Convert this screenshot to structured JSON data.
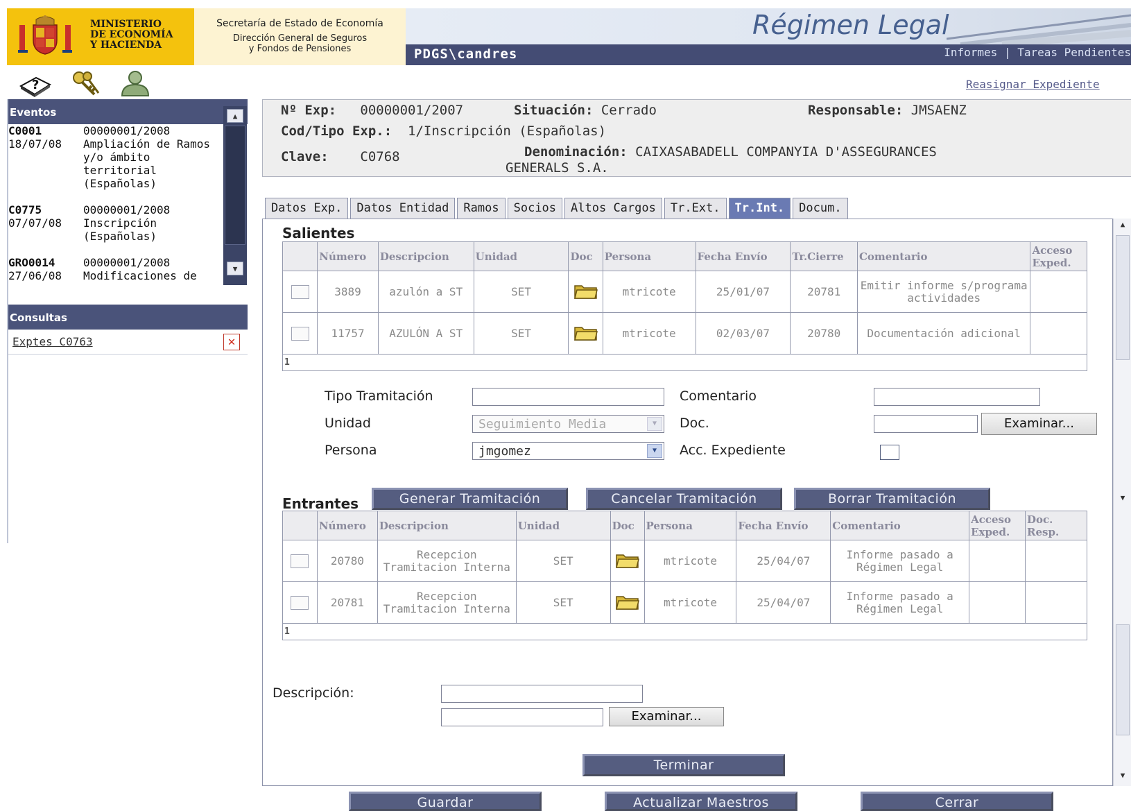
{
  "header": {
    "ministry_name": "MINISTERIO\nDE ECONOMÍA\nY HACIENDA",
    "secretaria": "Secretaría de Estado de Economía",
    "direccion": "Dirección General de Seguros\ny Fondos de Pensiones",
    "app_title": "Régimen Legal",
    "user": "PDGS\\candres",
    "link_informes": "Informes",
    "link_separator": "|",
    "link_tareas": "Tareas Pendientes"
  },
  "toolbar": {
    "icons": [
      "help-book-icon",
      "keys-icon",
      "user-icon"
    ]
  },
  "reassign_link": "Reasignar Expediente",
  "sidebar": {
    "events_title": "Eventos",
    "events": [
      {
        "code": "C0001",
        "exp": "00000001/2008",
        "date": "18/07/08",
        "desc": "Ampliación de Ramos y/o ámbito territorial (Españolas)"
      },
      {
        "code": "C0775",
        "exp": "00000001/2008",
        "date": "07/07/08",
        "desc": "Inscripción (Españolas)"
      },
      {
        "code": "GRO0014",
        "exp": "00000001/2008",
        "date": "27/06/08",
        "desc": "Modificaciones de"
      }
    ],
    "consultas_title": "Consultas",
    "consultas_link": "Exptes C0763"
  },
  "expediente": {
    "num_label": "Nº Exp:",
    "num_value": "00000001/2007",
    "situacion_label": "Situación:",
    "situacion_value": "Cerrado",
    "responsable_label": "Responsable:",
    "responsable_value": "JMSAENZ",
    "codtipo_label": "Cod/Tipo Exp.:",
    "codtipo_value": "1/Inscripción (Españolas)",
    "clave_label": "Clave:",
    "clave_value": "C0768",
    "denominacion_label": "Denominación:",
    "denominacion_value": "CAIXASABADELL COMPANYIA D'ASSEGURANCES",
    "denominacion_value2": "GENERALS S.A."
  },
  "tabs": [
    {
      "label": "Datos Exp.",
      "active": false
    },
    {
      "label": "Datos Entidad",
      "active": false
    },
    {
      "label": "Ramos",
      "active": false
    },
    {
      "label": "Socios",
      "active": false
    },
    {
      "label": "Altos Cargos",
      "active": false
    },
    {
      "label": "Tr.Ext.",
      "active": false
    },
    {
      "label": "Tr.Int.",
      "active": true
    },
    {
      "label": "Docum.",
      "active": false
    }
  ],
  "salientes": {
    "title": "Salientes",
    "headers": [
      "Número",
      "Descripcion",
      "Unidad",
      "Doc",
      "Persona",
      "Fecha Envío",
      "Tr.Cierre",
      "Comentario",
      "Acceso Exped."
    ],
    "rows": [
      {
        "numero": "3889",
        "descripcion": "azulón a ST",
        "unidad": "SET",
        "persona": "mtricote",
        "fecha": "25/01/07",
        "cierre": "20781",
        "comentario": "Emitir informe s/programa actividades",
        "acceso": ""
      },
      {
        "numero": "11757",
        "descripcion": "AZULÓN A ST",
        "unidad": "SET",
        "persona": "mtricote",
        "fecha": "02/03/07",
        "cierre": "20780",
        "comentario": "Documentación adicional",
        "acceso": ""
      }
    ],
    "page": "1"
  },
  "form": {
    "tipo_label": "Tipo Tramitación",
    "tipo_value": "",
    "comentario_label": "Comentario",
    "comentario_value": "",
    "unidad_label": "Unidad",
    "unidad_value": "Seguimiento Media",
    "doc_label": "Doc.",
    "doc_value": "",
    "examinar_label": "Examinar...",
    "persona_label": "Persona",
    "persona_value": "jmgomez",
    "acc_label": "Acc. Expediente",
    "acc_checked": false
  },
  "buttons": {
    "generar": "Generar Tramitación",
    "cancelar": "Cancelar Tramitación",
    "borrar": "Borrar Tramitación",
    "terminar": "Terminar",
    "guardar": "Guardar",
    "actualizar": "Actualizar Maestros",
    "cerrar": "Cerrar"
  },
  "entrantes": {
    "title": "Entrantes",
    "headers": [
      "Número",
      "Descripcion",
      "Unidad",
      "Doc",
      "Persona",
      "Fecha Envío",
      "Comentario",
      "Acceso Exped.",
      "Doc. Resp."
    ],
    "rows": [
      {
        "numero": "20780",
        "descripcion": "Recepcion Tramitacion Interna",
        "unidad": "SET",
        "persona": "mtricote",
        "fecha": "25/04/07",
        "comentario": "Informe pasado a Régimen Legal",
        "acceso": "",
        "docresp": ""
      },
      {
        "numero": "20781",
        "descripcion": "Recepcion Tramitacion Interna",
        "unidad": "SET",
        "persona": "mtricote",
        "fecha": "25/04/07",
        "comentario": "Informe pasado a Régimen Legal",
        "acceso": "",
        "docresp": ""
      }
    ],
    "page": "1"
  },
  "bottom_form": {
    "descripcion_label": "Descripción:",
    "descripcion_value": "",
    "file_value": "",
    "examinar_label": "Examinar..."
  },
  "colors": {
    "accent_dark": "#4a537a",
    "ministry_yellow": "#f4c20d",
    "active_tab": "#6a7ab3",
    "button_bg": "#555d80"
  }
}
